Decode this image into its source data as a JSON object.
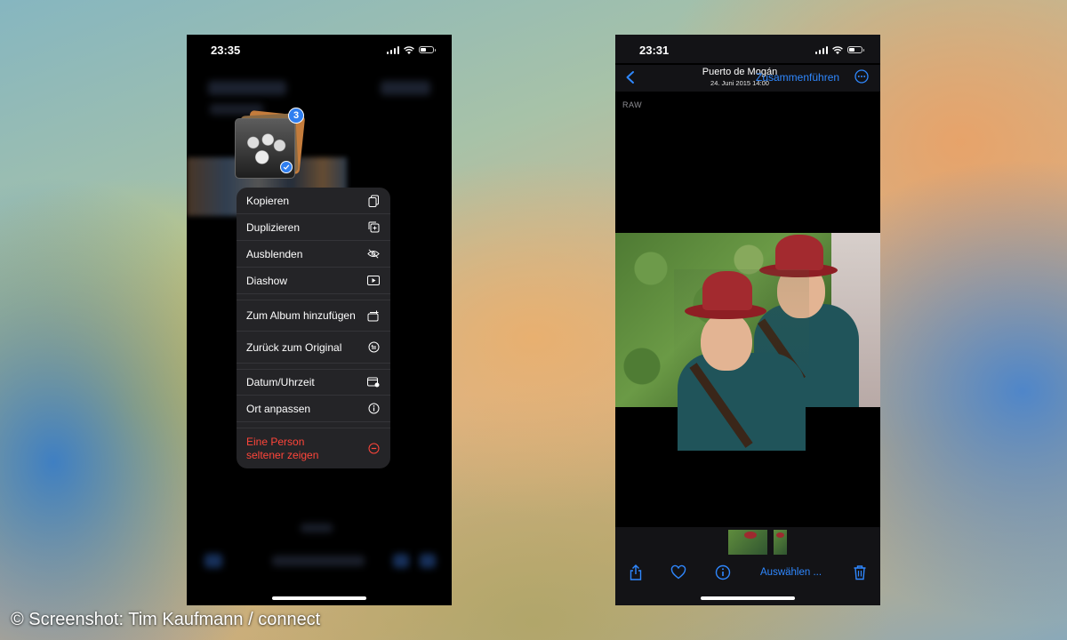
{
  "left_phone": {
    "status_time": "23:35",
    "selection_count": "3",
    "menu": {
      "items": [
        {
          "label": "Kopieren",
          "icon": "copy-icon"
        },
        {
          "label": "Duplizieren",
          "icon": "duplicate-icon"
        },
        {
          "label": "Ausblenden",
          "icon": "eye-slash-icon"
        },
        {
          "label": "Diashow",
          "icon": "play-rectangle-icon"
        },
        {
          "label": "Zum Album hinzufügen",
          "icon": "add-to-album-icon"
        },
        {
          "label": "Zurück zum Original",
          "icon": "revert-icon"
        },
        {
          "label": "Datum/Uhrzeit",
          "icon": "calendar-clock-icon"
        },
        {
          "label": "Ort anpassen",
          "icon": "info-icon"
        },
        {
          "label_line1": "Eine Person",
          "label_line2": "seltener zeigen",
          "icon": "minus-circle-icon"
        }
      ]
    }
  },
  "right_phone": {
    "status_time": "23:31",
    "nav": {
      "title": "Puerto de Mogán",
      "subtitle": "24. Juni 2015  14:00",
      "merge_label": "Zusammenführen"
    },
    "raw_label": "RAW",
    "toolbar": {
      "select_label": "Auswählen ..."
    }
  },
  "caption": "© Screenshot: Tim Kaufmann / connect",
  "colors": {
    "accent_blue": "#2f88ff",
    "destructive_red": "#ff453a",
    "menu_bg": "#242427"
  }
}
